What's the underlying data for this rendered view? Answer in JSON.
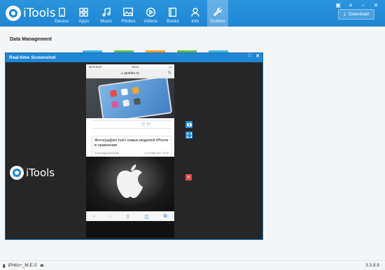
{
  "app": {
    "logo_text": "iTools",
    "colors": {
      "topbar": "#1f86d3",
      "accent": "#2d8ee0",
      "close": "#e24b4b"
    }
  },
  "nav": [
    {
      "label": "Device",
      "icon": "phone-icon"
    },
    {
      "label": "Apps",
      "icon": "apps-icon"
    },
    {
      "label": "Music",
      "icon": "music-icon"
    },
    {
      "label": "Photos",
      "icon": "photos-icon"
    },
    {
      "label": "Videos",
      "icon": "videos-icon"
    },
    {
      "label": "Books",
      "icon": "books-icon"
    },
    {
      "label": "Info",
      "icon": "user-icon"
    },
    {
      "label": "Toolbox",
      "icon": "wrench-icon",
      "active": true
    }
  ],
  "download_label": "Download",
  "section_title": "Data Management",
  "screenshot_window": {
    "title": "Real-time Screenshot",
    "logo_text": "iTools"
  },
  "phone": {
    "carrier": "MTS RUS",
    "time": "15:10",
    "url": "iguides.ru",
    "comment_count": "17",
    "article_title": "Фотография трёх новых моделей iPhone в сравнении",
    "author": "Александр Кузнецов",
    "date": "21 Мая 2017 14:00"
  },
  "statusbar": {
    "device": "iPh6s+_M.E.S",
    "version": "3.3.8.8"
  }
}
